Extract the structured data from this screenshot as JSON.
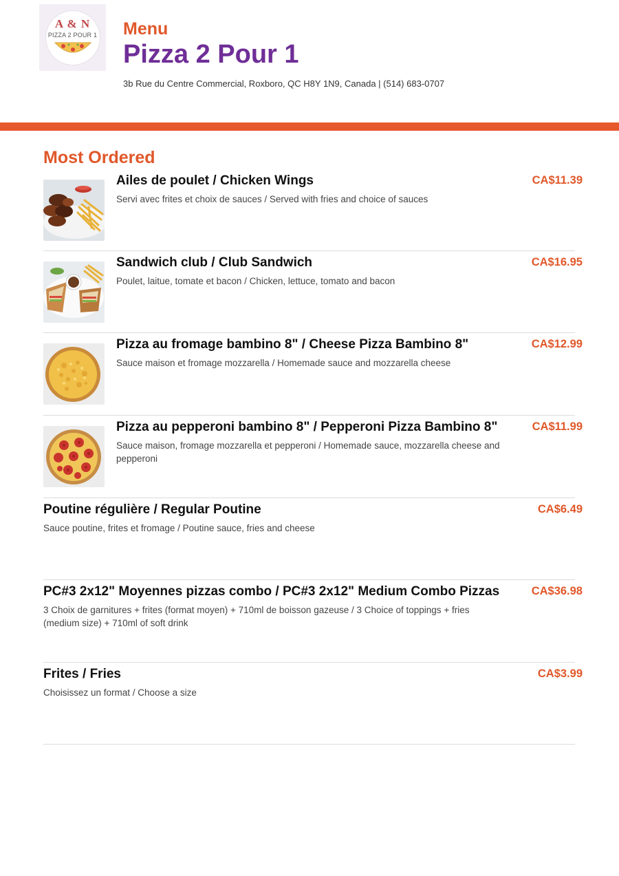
{
  "header": {
    "logo": {
      "line1": "A & N",
      "line2": "PIZZA 2 POUR 1"
    },
    "menu_label": "Menu",
    "restaurant_name": "Pizza 2 Pour 1",
    "address": "3b Rue du Centre Commercial, Roxboro, QC H8Y 1N9, Canada | (514) 683-0707"
  },
  "colors": {
    "accent_orange": "#e0582a",
    "brand_purple": "#6f2e97",
    "bar_orange": "#e6592c"
  },
  "section": {
    "title": "Most Ordered"
  },
  "items": [
    {
      "name": "Ailes de poulet / Chicken Wings",
      "description": "Servi avec frites et choix de sauces / Served with fries and choice of sauces",
      "price": "CA$11.39",
      "image": "chicken-wings-photo"
    },
    {
      "name": "Sandwich club / Club Sandwich",
      "description": "Poulet, laitue, tomate et bacon / Chicken, lettuce, tomato and bacon",
      "price": "CA$16.95",
      "image": "club-sandwich-photo"
    },
    {
      "name": "Pizza au fromage bambino 8\" / Cheese Pizza Bambino 8\"",
      "description": "Sauce maison et fromage mozzarella / Homemade sauce and mozzarella cheese",
      "price": "CA$12.99",
      "image": "cheese-pizza-photo"
    },
    {
      "name": "Pizza au pepperoni bambino 8\" / Pepperoni Pizza Bambino 8\"",
      "description": "Sauce maison, fromage mozzarella et pepperoni / Homemade sauce, mozzarella cheese and pepperoni",
      "price": "CA$11.99",
      "image": "pepperoni-pizza-photo"
    },
    {
      "name": "Poutine régulière / Regular Poutine",
      "description": "Sauce poutine, frites et fromage / Poutine sauce, fries and cheese",
      "price": "CA$6.49"
    },
    {
      "name": "PC#3 2x12\" Moyennes pizzas combo / PC#3 2x12\" Medium Combo Pizzas",
      "description": "3 Choix de garnitures + frites (format moyen) + 710ml de boisson gazeuse / 3 Choice of toppings + fries (medium size) + 710ml of soft drink",
      "price": "CA$36.98"
    },
    {
      "name": "Frites / Fries",
      "description": "Choisissez un format / Choose a size",
      "price": "CA$3.99"
    }
  ]
}
